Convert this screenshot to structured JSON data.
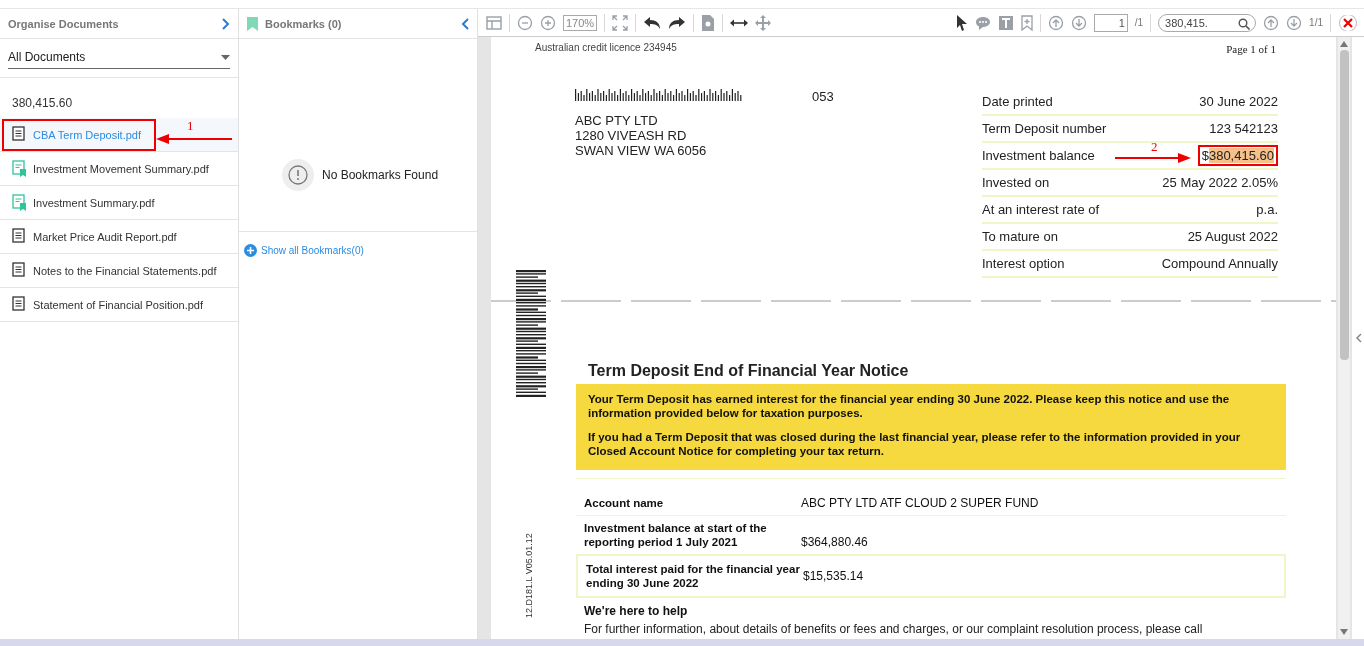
{
  "organise_panel": {
    "title": "Organise Documents",
    "filter": {
      "value": "All Documents"
    },
    "search_term": "380,415.60",
    "documents": [
      {
        "name": "CBA Term Deposit.pdf",
        "kind": "plain",
        "selected": true
      },
      {
        "name": "Investment Movement Summary.pdf",
        "kind": "bookmarked",
        "selected": false
      },
      {
        "name": "Investment Summary.pdf",
        "kind": "bookmarked",
        "selected": false
      },
      {
        "name": "Market Price Audit Report.pdf",
        "kind": "plain",
        "selected": false
      },
      {
        "name": "Notes to the Financial Statements.pdf",
        "kind": "plain",
        "selected": false
      },
      {
        "name": "Statement of Financial Position.pdf",
        "kind": "plain",
        "selected": false
      }
    ]
  },
  "bookmarks_panel": {
    "title": "Bookmarks (0)",
    "empty_message": "No Bookmarks Found",
    "show_all_link": "Show all Bookmarks(0)"
  },
  "toolbar": {
    "zoom": "170%",
    "page_input": "1",
    "page_total": "/1",
    "search": {
      "value": "380,415."
    },
    "match_count": "1/1"
  },
  "document": {
    "licence": "Australian credit licence 234945",
    "page_label": "Page 1 of 1",
    "code": "053",
    "address": [
      "ABC PTY LTD",
      "1280 VIVEASH RD",
      "SWAN VIEW WA 6056"
    ],
    "details": [
      {
        "label": "Date printed",
        "value": "30 June 2022"
      },
      {
        "label": "Term Deposit number",
        "value": "123  542123"
      },
      {
        "label": "Investment balance",
        "value": "$",
        "highlight": "380,415.60"
      },
      {
        "label": "Invested on",
        "value": "25 May 2022 2.05%"
      },
      {
        "label": "At an interest rate of",
        "value": "p.a."
      },
      {
        "label": "To mature on",
        "value": "25 August 2022"
      },
      {
        "label": "Interest option",
        "value": "Compound  Annually"
      }
    ],
    "side_code": "12.D181.L V05.01.12",
    "notice_title": "Term Deposit End of Financial Year Notice",
    "notice_paragraphs": [
      "Your Term Deposit has earned interest for the financial year ending 30 June 2022. Please keep this notice and use the information provided below for taxation purposes.",
      "If you had a Term Deposit that was closed during the last financial year, please refer to the information provided in your Closed Account Notice for completing your tax return."
    ],
    "summary": [
      {
        "label": "Account name",
        "value": "ABC PTY LTD ATF CLOUD 2 SUPER FUND"
      },
      {
        "label": "Investment balance at start of the reporting period 1 July 2021",
        "value": "$364,880.46"
      },
      {
        "label": "Total interest paid for the financial year ending 30 June 2022",
        "value": "$15,535.14"
      }
    ],
    "help_title": "We're here to help",
    "help_text": "For further information, about details of benefits or fees and charges, or our complaint resolution process, please call"
  },
  "annotations": [
    {
      "label": "1"
    },
    {
      "label": "2"
    }
  ]
}
